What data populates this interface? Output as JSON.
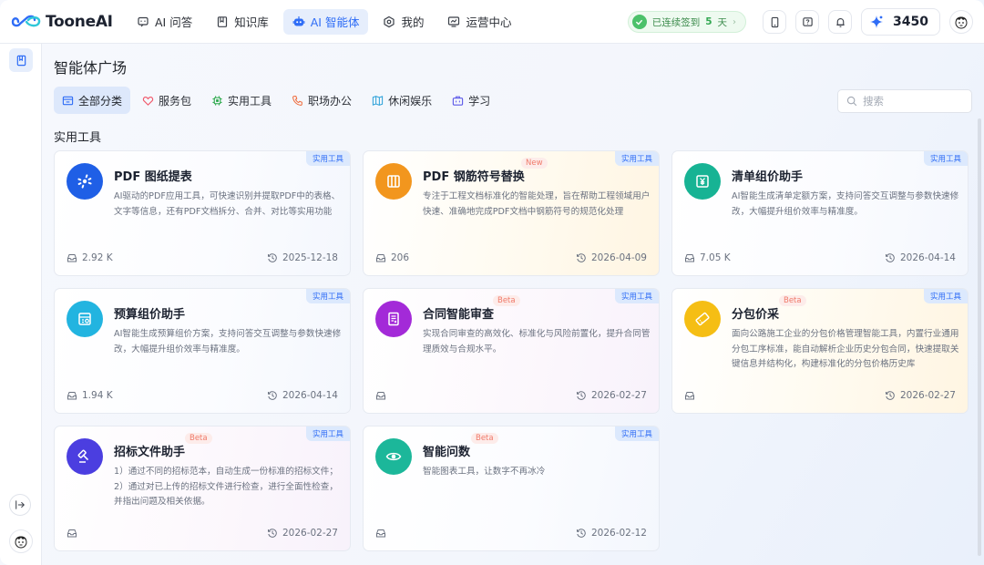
{
  "app": {
    "brand": "TooneAI"
  },
  "nav": [
    {
      "label": "AI 问答",
      "icon": "chat-icon"
    },
    {
      "label": "知识库",
      "icon": "book-icon"
    },
    {
      "label": "AI 智能体",
      "icon": "robot-icon",
      "active": true
    },
    {
      "label": "我的",
      "icon": "hexagon-icon"
    },
    {
      "label": "运营中心",
      "icon": "monitor-icon"
    }
  ],
  "checkin": {
    "prefix": "已连续签到",
    "days": "5",
    "unit": "天"
  },
  "points": "3450",
  "page": {
    "title": "智能体广场",
    "section": "实用工具"
  },
  "filters": [
    {
      "label": "全部分类",
      "icon": "category-icon",
      "active": true,
      "color": "#2f6df6"
    },
    {
      "label": "服务包",
      "icon": "heart-icon",
      "color": "#f0596b"
    },
    {
      "label": "实用工具",
      "icon": "chip-icon",
      "color": "#2aa84a"
    },
    {
      "label": "职场办公",
      "icon": "phone-icon",
      "color": "#ef6a3a"
    },
    {
      "label": "休闲娱乐",
      "icon": "map-icon",
      "color": "#2aa0d8"
    },
    {
      "label": "学习",
      "icon": "briefcase-icon",
      "color": "#5b58e8"
    }
  ],
  "search": {
    "placeholder": "搜索"
  },
  "cards": [
    {
      "title": "PDF 图纸提表",
      "badge": "实用工具",
      "tag": "",
      "desc": "AI驱动的PDF应用工具，可快速识别并提取PDF中的表格、文字等信息，还有PDF文档拆分、合并、对比等实用功能",
      "count": "2.92 K",
      "date": "2025-12-18",
      "icon": "pdf-table-icon",
      "color": "#1f5fe6"
    },
    {
      "title": "PDF 钢筋符号替换",
      "badge": "实用工具",
      "tag": "New",
      "desc": "专注于工程文档标准化的智能处理，旨在帮助工程领域用户快速、准确地完成PDF文档中钢筋符号的规范化处理",
      "count": "206",
      "date": "2026-04-09",
      "icon": "rebar-icon",
      "color": "#f2961e"
    },
    {
      "title": "清单组价助手",
      "badge": "实用工具",
      "tag": "",
      "desc": "AI智能生成清单定额方案，支持问答交互调整与参数快速修改，大幅提升组价效率与精准度。",
      "count": "7.05 K",
      "date": "2026-04-14",
      "icon": "yuan-list-icon",
      "color": "#17b394"
    },
    {
      "title": "预算组价助手",
      "badge": "实用工具",
      "tag": "",
      "desc": "AI智能生成预算组价方案，支持问答交互调整与参数快速修改，大幅提升组价效率与精准度。",
      "count": "1.94 K",
      "date": "2026-04-14",
      "icon": "budget-icon",
      "color": "#22b4e0"
    },
    {
      "title": "合同智能审查",
      "badge": "实用工具",
      "tag": "Beta",
      "desc": "实现合同审查的高效化、标准化与风险前置化，提升合同管理质效与合规水平。",
      "count": "",
      "date": "2026-02-27",
      "icon": "contract-icon",
      "color": "#a32ad8"
    },
    {
      "title": "分包价采",
      "badge": "实用工具",
      "tag": "Beta",
      "desc": "面向公路施工企业的分包价格管理智能工具，内置行业通用分包工序标准，能自动解析企业历史分包合同，快速提取关键信息并结构化，构建标准化的分包价格历史库",
      "count": "",
      "date": "2026-02-27",
      "icon": "ticket-icon",
      "color": "#f5be14"
    },
    {
      "title": "招标文件助手",
      "badge": "实用工具",
      "tag": "Beta",
      "desc": "1）通过不同的招标范本，自动生成一份标准的招标文件； 2）通过对已上传的招标文件进行检查，进行全面性检查，并指出问题及相关依据。",
      "count": "",
      "date": "2026-02-27",
      "icon": "gavel-icon",
      "color": "#4b3ee0"
    },
    {
      "title": "智能问数",
      "badge": "实用工具",
      "tag": "Beta",
      "desc": "智能图表工具，让数字不再冰冷",
      "count": "",
      "date": "2026-02-12",
      "icon": "eye-icon",
      "color": "#1cb79a"
    }
  ]
}
